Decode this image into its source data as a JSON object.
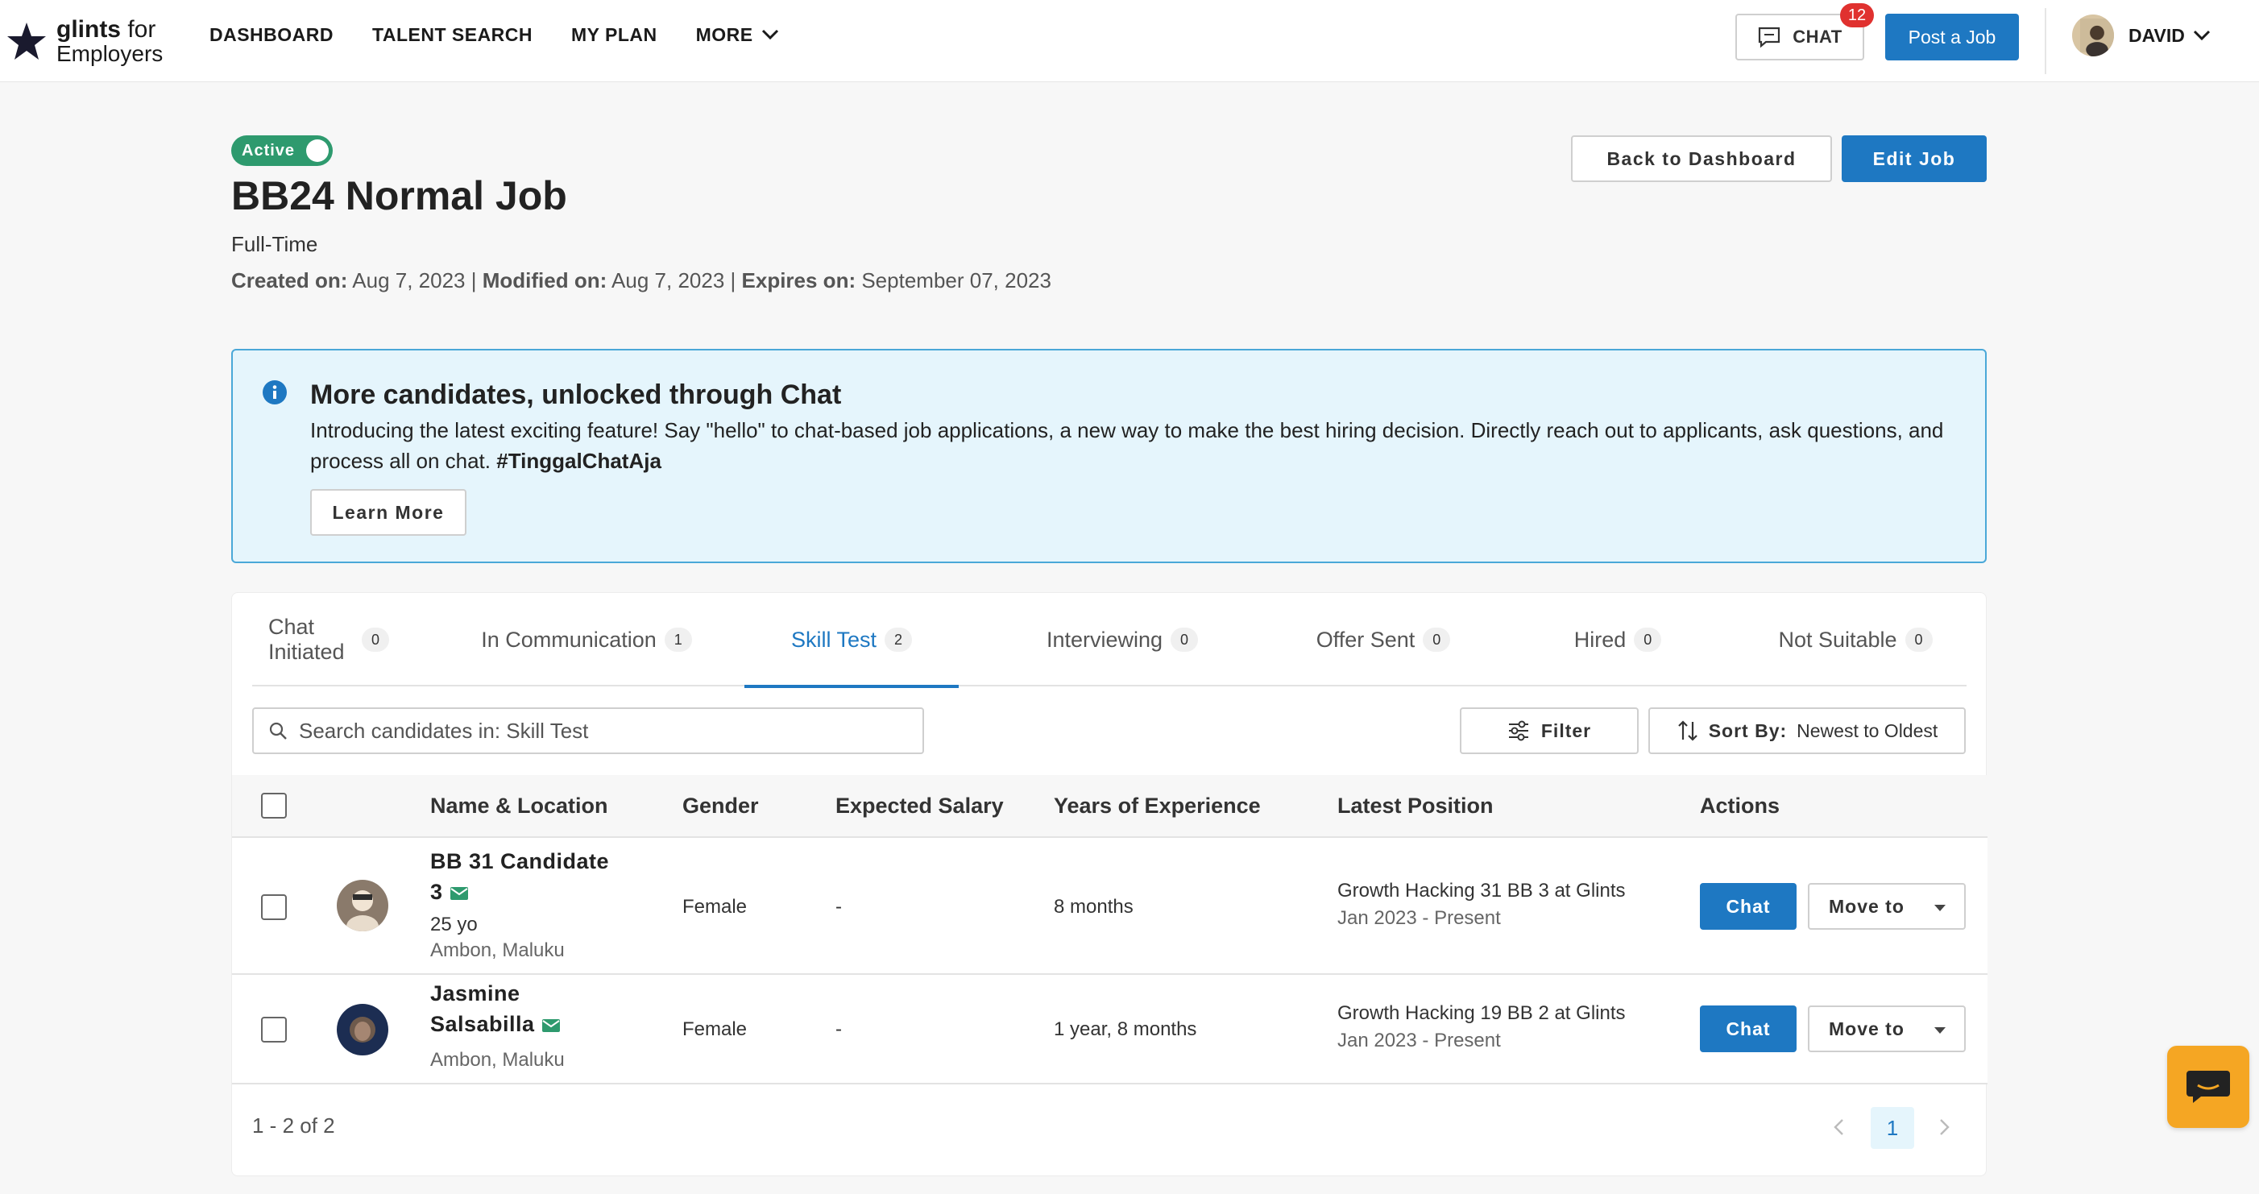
{
  "brand": {
    "name": "glints",
    "suffix": "for",
    "line2": "Employers"
  },
  "nav": {
    "items": [
      "DASHBOARD",
      "TALENT SEARCH",
      "MY PLAN",
      "MORE"
    ],
    "chat_label": "CHAT",
    "chat_badge": "12",
    "post_job_label": "Post a Job",
    "user_name": "DAVID"
  },
  "job": {
    "status": "Active",
    "title": "BB24 Normal Job",
    "type": "Full-Time",
    "created_label": "Created on:",
    "created": "Aug 7, 2023",
    "modified_label": "Modified on:",
    "modified": "Aug 7, 2023",
    "expires_label": "Expires on:",
    "expires": "September 07, 2023",
    "separator": "|",
    "back_label": "Back to Dashboard",
    "edit_label": "Edit Job"
  },
  "banner": {
    "title": "More candidates, unlocked through Chat",
    "text": "Introducing the latest exciting feature! Say \"hello\" to chat-based job applications, a new way to make the best hiring decision. Directly reach out to applicants, ask questions, and process all on chat.",
    "hashtag": "#TinggalChatAja",
    "button": "Learn More"
  },
  "tabs": [
    {
      "label": "Chat Initiated",
      "count": "0"
    },
    {
      "label": "In Communication",
      "count": "1"
    },
    {
      "label": "Skill Test",
      "count": "2"
    },
    {
      "label": "Interviewing",
      "count": "0"
    },
    {
      "label": "Offer Sent",
      "count": "0"
    },
    {
      "label": "Hired",
      "count": "0"
    },
    {
      "label": "Not Suitable",
      "count": "0"
    }
  ],
  "active_tab": "Skill Test",
  "search": {
    "placeholder": "Search candidates in: Skill Test"
  },
  "filter_label": "Filter",
  "sort": {
    "label": "Sort By:",
    "value": "Newest to Oldest"
  },
  "columns": [
    "Name & Location",
    "Gender",
    "Expected Salary",
    "Years of Experience",
    "Latest Position",
    "Actions"
  ],
  "candidates": [
    {
      "name_line1": "BB 31 Candidate",
      "name_line2": "3",
      "age": "25 yo",
      "location": "Ambon, Maluku",
      "gender": "Female",
      "salary": "-",
      "experience": "8 months",
      "position": "Growth Hacking 31 BB 3 at Glints",
      "position_date": "Jan 2023 - Present",
      "chat_label": "Chat",
      "move_label": "Move to"
    },
    {
      "name_line1": "Jasmine",
      "name_line2": "Salsabilla",
      "location": "Ambon, Maluku",
      "gender": "Female",
      "salary": "-",
      "experience": "1 year, 8 months",
      "position": "Growth Hacking 19 BB 2 at Glints",
      "position_date": "Jan 2023 - Present",
      "chat_label": "Chat",
      "move_label": "Move to"
    }
  ],
  "pagination": {
    "summary": "1 - 2 of 2",
    "current_page": "1"
  },
  "colors": {
    "primary": "#1e78c2",
    "active_green": "#2e9a6e",
    "badge_red": "#e0312f",
    "banner_bg": "#e5f5fc",
    "fab_orange": "#f5a623"
  }
}
